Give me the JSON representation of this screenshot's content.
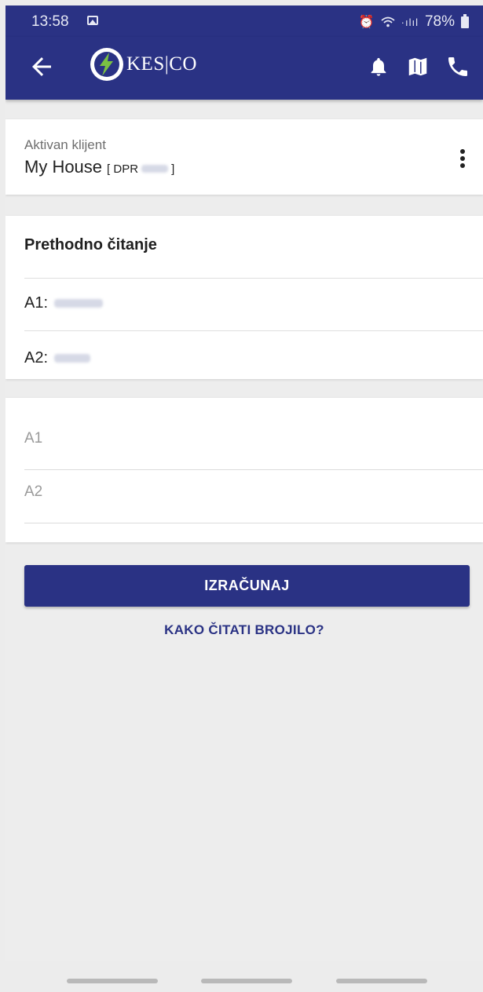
{
  "status_bar": {
    "time": "13:58",
    "signal": "·ılıl",
    "battery": "78%"
  },
  "app_bar": {
    "logo_text": "KES|CO",
    "brand_color": "#2a3284",
    "accent_color": "#7ac143"
  },
  "client": {
    "label": "Aktivan klijent",
    "name": "My House",
    "code_prefix": "[ DPR",
    "code_suffix": "]"
  },
  "previous_reading": {
    "title": "Prethodno čitanje",
    "rows": [
      {
        "label": "A1:"
      },
      {
        "label": "A2:"
      }
    ]
  },
  "inputs": {
    "a1_placeholder": "A1",
    "a2_placeholder": "A2"
  },
  "actions": {
    "calculate_label": "IZRAČUNAJ",
    "help_link": "KAKO ČITATI BROJILO?"
  }
}
